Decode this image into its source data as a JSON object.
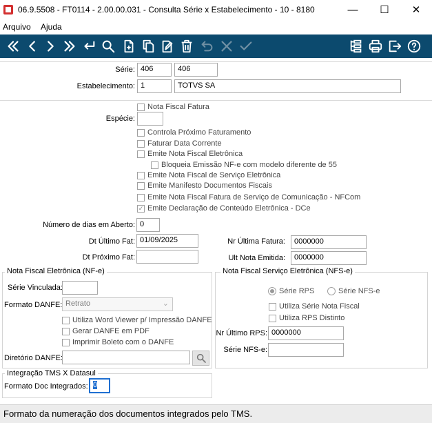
{
  "window": {
    "title": "06.9.5508 - FT0114 - 2.00.00.031 - Consulta Série x Estabelecimento - 10 - 8180",
    "minimize": "—",
    "maximize": "☐",
    "close": "✕"
  },
  "menu": {
    "items": [
      "Arquivo",
      "Ajuda"
    ]
  },
  "toolbar": {
    "icons": [
      "first-icon",
      "prev-icon",
      "next-icon",
      "last-icon",
      "goto-icon",
      "search-icon",
      "new-icon",
      "copy-icon",
      "edit-icon",
      "delete-icon",
      "undo-icon",
      "cancel-icon",
      "confirm-icon",
      "tree-icon",
      "print-icon",
      "exit-icon",
      "help-icon"
    ],
    "colors": {
      "background": "#0c4a6e",
      "enabled": "#ffffff",
      "disabled": "#6f8fa3"
    }
  },
  "header": {
    "serie_label": "Série:",
    "serie_value": "406",
    "serie_desc": "406",
    "estab_label": "Estabelecimento:",
    "estab_value": "1",
    "estab_desc": "TOTVS SA"
  },
  "form": {
    "nota_fiscal_fatura": "Nota Fiscal Fatura",
    "especie_label": "Espécie:",
    "especie_value": "",
    "checks": {
      "controla_prox": "Controla Próximo Faturamento",
      "faturar_data": "Faturar Data Corrente",
      "emite_nfe": "Emite Nota Fiscal Eletrônica",
      "bloqueia": "Bloqueia Emissão NF-e com modelo diferente de 55",
      "emite_nfse": "Emite Nota Fiscal de Serviço Eletrônica",
      "emite_mdfe": "Emite Manifesto Documentos Fiscais",
      "emite_nfcom": "Emite Nota Fiscal Fatura de Serviço de Comunicação - NFCom",
      "emite_dce": "Emite Declaração de Conteúdo Eletrônica - DCe"
    },
    "dias_label": "Número de dias em Aberto:",
    "dias_value": "0",
    "dt_ult_fat_label": "Dt Último Fat:",
    "dt_ult_fat_value": "01/09/2025",
    "dt_prox_fat_label": "Dt Próximo Fat:",
    "dt_prox_fat_value": "",
    "nr_ult_fatura_label": "Nr Última Fatura:",
    "nr_ult_fatura_value": "0000000",
    "ult_nota_label": "Ult Nota Emitida:",
    "ult_nota_value": "0000000"
  },
  "nfe": {
    "legend": "Nota Fiscal Eletrônica (NF-e)",
    "serie_vinc_label": "Série Vinculada:",
    "serie_vinc_value": "",
    "formato_label": "Formato DANFE:",
    "formato_value": "Retrato",
    "word_viewer": "Utiliza Word Viewer p/ Impressão DANFE",
    "gerar_pdf": "Gerar DANFE em PDF",
    "boleto": "Imprimir Boleto com o DANFE",
    "diretorio_label": "Diretório DANFE:",
    "diretorio_value": ""
  },
  "nfse": {
    "legend": "Nota Fiscal Serviço Eletrônica (NFS-e)",
    "serie_rps": "Série RPS",
    "serie_nfse_radio": "Série NFS-e",
    "utiliza_serie_nf": "Utiliza Série Nota Fiscal",
    "utiliza_rps": "Utiliza RPS Distinto",
    "nr_ult_rps_label": "Nr Último RPS:",
    "nr_ult_rps_value": "0000000",
    "serie_nfse_label": "Série NFS-e:",
    "serie_nfse_value": ""
  },
  "tms": {
    "legend": "Integração TMS X Datasul",
    "formato_label": "Formato Doc Integrados:",
    "formato_value": "0"
  },
  "status": {
    "text": "Formato da numeração dos documentos integrados pelo TMS."
  }
}
